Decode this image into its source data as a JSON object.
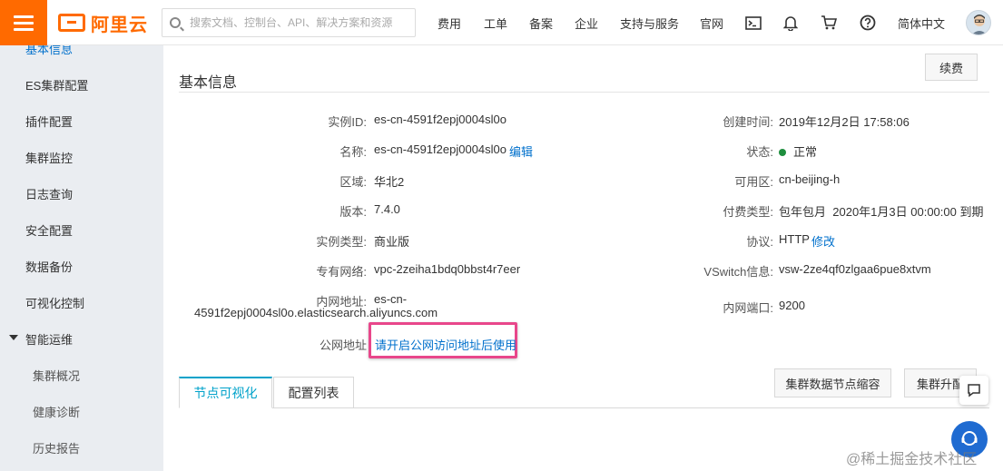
{
  "topbar": {
    "logo_text": "阿里云",
    "search_placeholder": "搜索文档、控制台、API、解决方案和资源",
    "nav": [
      "费用",
      "工单",
      "备案",
      "企业",
      "支持与服务",
      "官网"
    ],
    "language": "简体中文",
    "icons": [
      "terminal-icon",
      "bell-icon",
      "cart-icon",
      "help-icon"
    ]
  },
  "sidebar": {
    "items": [
      {
        "label": "基本信息",
        "active": true
      },
      {
        "label": "ES集群配置"
      },
      {
        "label": "插件配置"
      },
      {
        "label": "集群监控"
      },
      {
        "label": "日志查询"
      },
      {
        "label": "安全配置"
      },
      {
        "label": "数据备份"
      },
      {
        "label": "可视化控制"
      },
      {
        "label": "智能运维",
        "expanded": true
      }
    ],
    "subitems": [
      "集群概况",
      "健康诊断",
      "历史报告"
    ]
  },
  "main": {
    "title": "基本信息",
    "renew_button": "续费",
    "left": {
      "instance_id_label": "实例ID:",
      "instance_id": "es-cn-4591f2epj0004sl0o",
      "name_label": "名称:",
      "name": "es-cn-4591f2epj0004sl0o",
      "edit_link": "编辑",
      "region_label": "区域:",
      "region": "华北2",
      "version_label": "版本:",
      "version": "7.4.0",
      "type_label": "实例类型:",
      "type": "商业版",
      "vpc_label": "专有网络:",
      "vpc": "vpc-2zeiha1bdq0bbst4r7eer",
      "intranet_label": "内网地址:",
      "intranet_line1": "es-cn-",
      "intranet_line2": "4591f2epj0004sl0o.elasticsearch.aliyuncs.com",
      "public_label": "公网地址",
      "public_link": "请开启公网访问地址后使用"
    },
    "right": {
      "created_label": "创建时间:",
      "created": "2019年12月2日 17:58:06",
      "status_label": "状态:",
      "status": "正常",
      "status_color": "#1e8e3e",
      "zone_label": "可用区:",
      "zone": "cn-beijing-h",
      "billing_label": "付费类型:",
      "billing": "包年包月",
      "billing_expire": "2020年1月3日 00:00:00 到期",
      "protocol_label": "协议:",
      "protocol": "HTTP",
      "protocol_link": "修改",
      "vswitch_label": "VSwitch信息:",
      "vswitch": "vsw-2ze4qf0zlgaa6pue8xtvm",
      "port_label": "内网端口:",
      "port": "9200"
    },
    "tabs": [
      "节点可视化",
      "配置列表"
    ],
    "actions": {
      "shrink": "集群数据节点缩容",
      "upgrade": "集群升配"
    }
  },
  "watermark": "@稀土掘金技术社区",
  "colors": {
    "brand": "#ff6a00",
    "link": "#0070cc",
    "tab_active": "#00a2ca",
    "highlight": "#e8478b"
  }
}
